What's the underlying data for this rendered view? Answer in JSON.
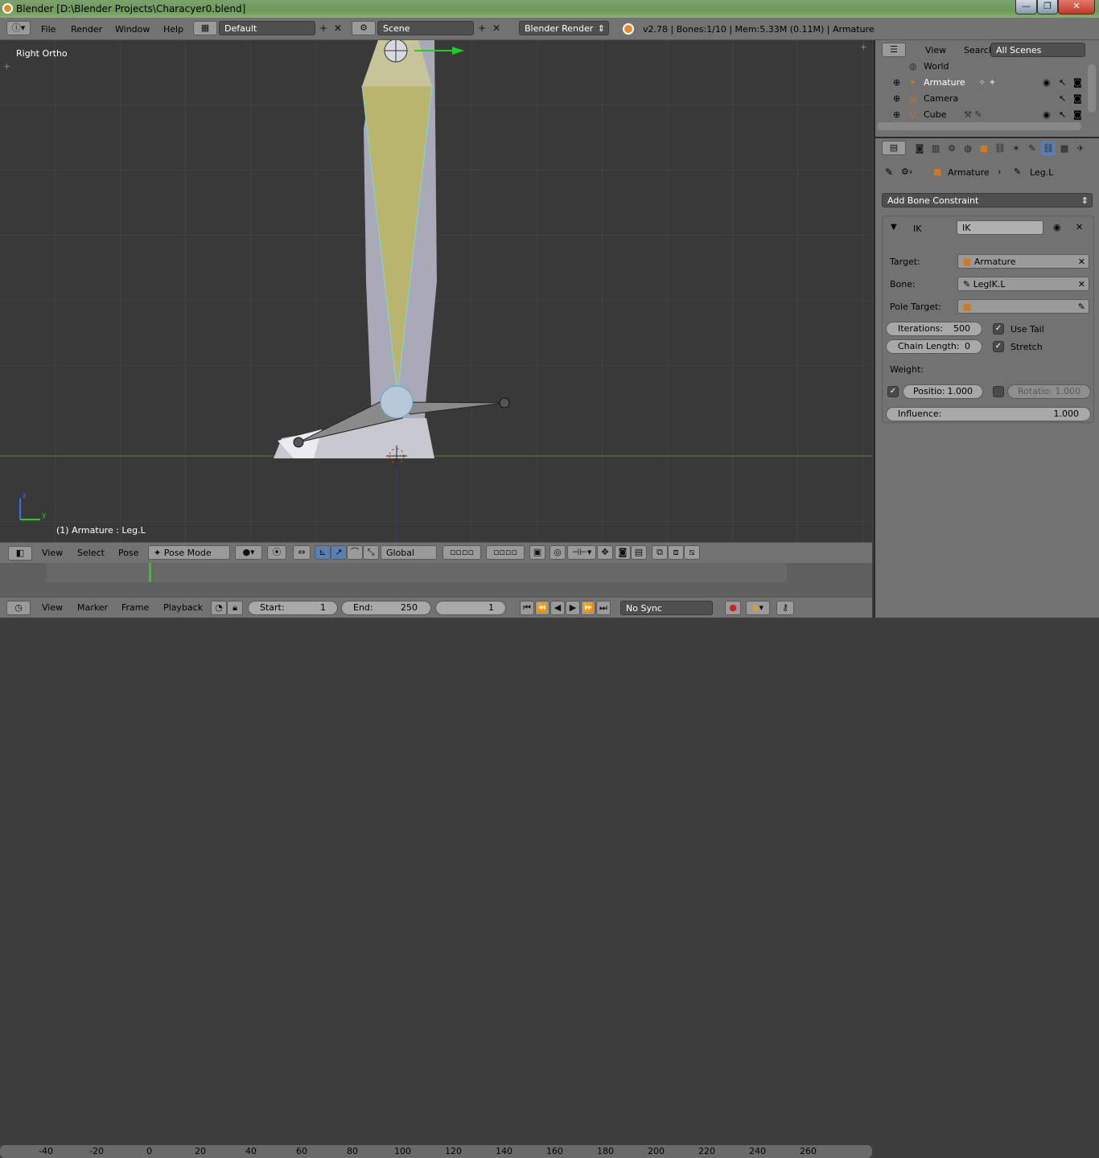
{
  "window": {
    "title": "Blender [D:\\Blender Projects\\Characyer0.blend]",
    "minimize": "—",
    "maximize": "❐",
    "close": "✕"
  },
  "info_header": {
    "menus": [
      "File",
      "Render",
      "Window",
      "Help"
    ],
    "layout": "Default",
    "scene": "Scene",
    "engine": "Blender Render",
    "stats": "v2.78 | Bones:1/10  | Mem:5.33M (0.11M) | Armature"
  },
  "viewport": {
    "view_label": "Right Ortho",
    "status": "(1) Armature : Leg.L",
    "axis_z": "z",
    "axis_y": "y",
    "header": {
      "menus": [
        "View",
        "Select",
        "Pose"
      ],
      "mode": "Pose Mode",
      "orientation": "Global"
    }
  },
  "timeline": {
    "ticks": [
      "-40",
      "-20",
      "0",
      "20",
      "40",
      "60",
      "80",
      "100",
      "120",
      "140",
      "160",
      "180",
      "200",
      "220",
      "240",
      "260"
    ],
    "menus": [
      "View",
      "Marker",
      "Frame",
      "Playback"
    ],
    "start_label": "Start:",
    "start_value": "1",
    "end_label": "End:",
    "end_value": "250",
    "current_frame": "1",
    "sync": "No Sync"
  },
  "outliner": {
    "menus": [
      "View",
      "Search"
    ],
    "scene_filter": "All Scenes",
    "items": [
      {
        "label": "World",
        "icon": "world-icon"
      },
      {
        "label": "Armature",
        "icon": "armature-icon"
      },
      {
        "label": "Camera",
        "icon": "camera-icon"
      },
      {
        "label": "Cube",
        "icon": "mesh-icon"
      }
    ]
  },
  "properties": {
    "breadcrumb_object": "Armature",
    "breadcrumb_bone": "Leg.L",
    "add_constraint": "Add Bone Constraint",
    "constraint": {
      "type": "IK",
      "name": "IK",
      "target_label": "Target:",
      "target_value": "Armature",
      "bone_label": "Bone:",
      "bone_value": "LegIK.L",
      "pole_label": "Pole Target:",
      "pole_value": "",
      "iterations_label": "Iterations:",
      "iterations_value": "500",
      "chain_label": "Chain Length:",
      "chain_value": "0",
      "use_tail": "Use Tail",
      "stretch": "Stretch",
      "weight_label": "Weight:",
      "position_label": "Positio:",
      "position_value": "1.000",
      "rotation_label": "Rotatio:",
      "rotation_value": "1.000",
      "influence_label": "Influence:",
      "influence_value": "1.000"
    }
  }
}
